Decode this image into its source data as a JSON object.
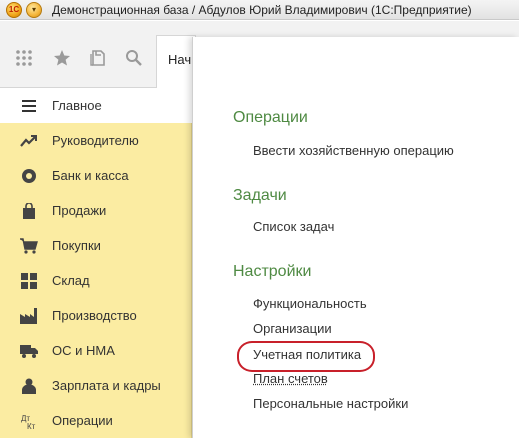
{
  "window": {
    "title": "Демонстрационная база / Абдулов Юрий Владимирович  (1С:Предприятие)",
    "logo_text": "1С"
  },
  "toolbar": {
    "icons": [
      "apps-grid-icon",
      "star-icon",
      "history-icon",
      "search-icon"
    ],
    "tab_label": "Нач"
  },
  "sidebar": {
    "items": [
      {
        "label": "Главное",
        "icon": "menu-lines-icon",
        "active": true
      },
      {
        "label": "Руководителю",
        "icon": "trend-up-icon",
        "active": false
      },
      {
        "label": "Банк и касса",
        "icon": "coins-icon",
        "active": false
      },
      {
        "label": "Продажи",
        "icon": "bag-icon",
        "active": false
      },
      {
        "label": "Покупки",
        "icon": "cart-icon",
        "active": false
      },
      {
        "label": "Склад",
        "icon": "warehouse-icon",
        "active": false
      },
      {
        "label": "Производство",
        "icon": "factory-icon",
        "active": false
      },
      {
        "label": "ОС и НМА",
        "icon": "truck-icon",
        "active": false
      },
      {
        "label": "Зарплата и кадры",
        "icon": "person-icon",
        "active": false
      },
      {
        "label": "Операции",
        "icon": "debit-credit-icon",
        "active": false
      }
    ]
  },
  "main": {
    "sections": [
      {
        "title": "Операции",
        "links": [
          "Ввести хозяйственную операцию"
        ]
      },
      {
        "title": "Задачи",
        "links": [
          "Список задач"
        ]
      },
      {
        "title": "Настройки",
        "links": [
          "Функциональность",
          "Организации",
          "Учетная политика",
          "План счетов",
          "Персональные настройки"
        ]
      }
    ]
  },
  "colors": {
    "sidebar_bg": "#fbeca2",
    "section_title": "#4f8a43",
    "highlight_oval": "#c8202a"
  }
}
